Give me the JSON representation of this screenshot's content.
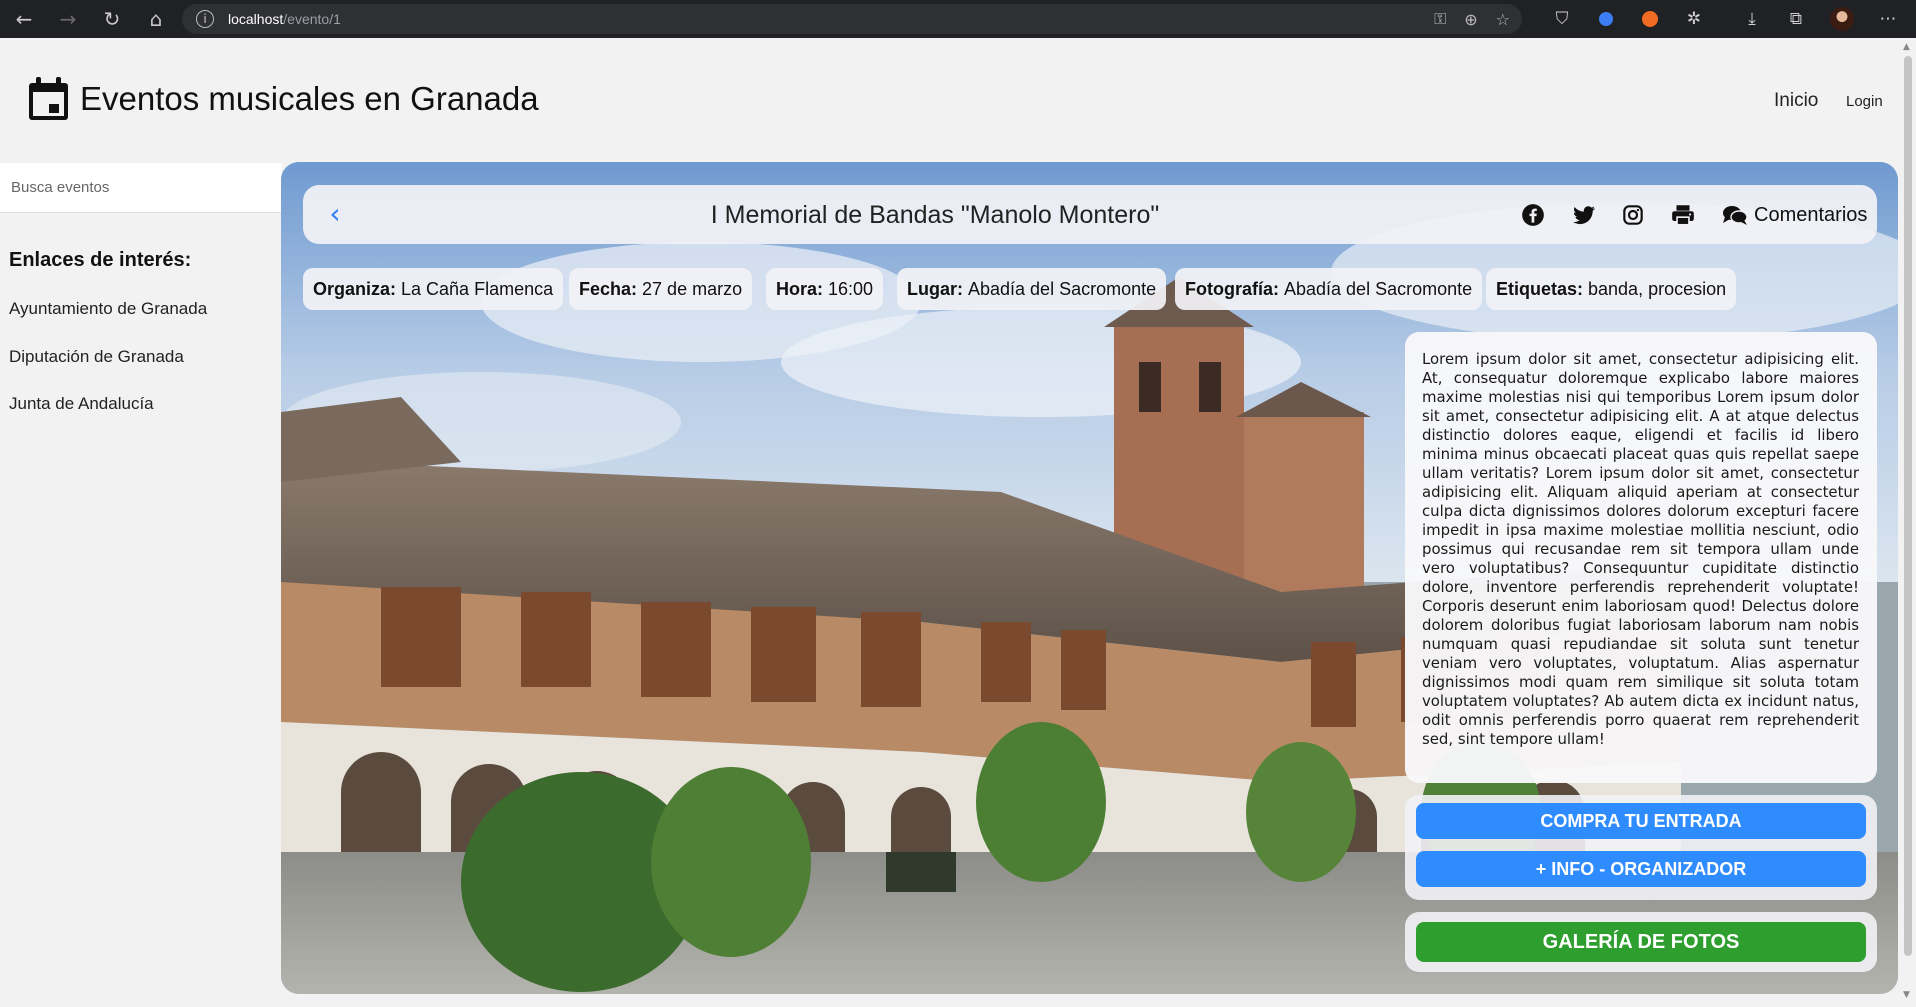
{
  "browser": {
    "url_host": "localhost",
    "url_path": "/evento/1"
  },
  "header": {
    "site_title": "Eventos musicales en Granada",
    "nav": {
      "inicio": "Inicio",
      "login": "Login"
    }
  },
  "sidebar": {
    "search_placeholder": "Busca eventos",
    "links_title": "Enlaces de interés:",
    "links": [
      "Ayuntamiento de Granada",
      "Diputación de Granada",
      "Junta de Andalucía"
    ]
  },
  "event": {
    "title": "I Memorial de Bandas \"Manolo Montero\"",
    "comments_label": "Comentarios",
    "share_icons": [
      "facebook-icon",
      "twitter-icon",
      "instagram-icon",
      "print-icon"
    ],
    "details": [
      {
        "label": "Organiza:",
        "value": "La Caña Flamenca"
      },
      {
        "label": "Fecha:",
        "value": "27 de marzo"
      },
      {
        "label": "Hora:",
        "value": "16:00"
      },
      {
        "label": "Lugar:",
        "value": "Abadía del Sacromonte"
      },
      {
        "label": "Fotografía:",
        "value": "Abadía del Sacromonte"
      },
      {
        "label": "Etiquetas:",
        "value": "banda, procesion"
      }
    ],
    "description": "Lorem ipsum dolor sit amet, consectetur adipisicing elit. At, consequatur doloremque explicabo labore maiores maxime molestias nisi qui temporibus Lorem ipsum dolor sit amet, consectetur adipisicing elit. A at atque delectus distinctio dolores eaque, eligendi et facilis id libero minima minus obcaecati placeat quas quis repellat saepe ullam veritatis? Lorem ipsum dolor sit amet, consectetur adipisicing elit. Aliquam aliquid aperiam at consectetur culpa dicta dignissimos dolores dolorum excepturi facere impedit in ipsa maxime molestiae mollitia nesciunt, odio possimus qui recusandae rem sit tempora ullam unde vero voluptatibus? Consequuntur cupiditate distinctio dolore, inventore perferendis reprehenderit voluptate! Corporis deserunt enim laboriosam quod! Delectus dolore dolorem doloribus fugiat laboriosam laborum nam nobis numquam quasi repudiandae sit soluta sunt tenetur veniam vero voluptates, voluptatum. Alias aspernatur dignissimos modi quam rem similique sit soluta totam voluptatem voluptates? Ab autem dicta ex incidunt natus, odit omnis perferendis porro quaerat rem reprehenderit sed, sint tempore ullam!",
    "buttons": {
      "buy": "COMPRA TU ENTRADA",
      "info": "+ INFO - ORGANIZADOR",
      "gallery": "GALERÍA DE FOTOS"
    }
  },
  "colors": {
    "primary_button": "#2f8cff",
    "gallery_button": "#2e9e2e",
    "back_arrow": "#2e7df6"
  }
}
